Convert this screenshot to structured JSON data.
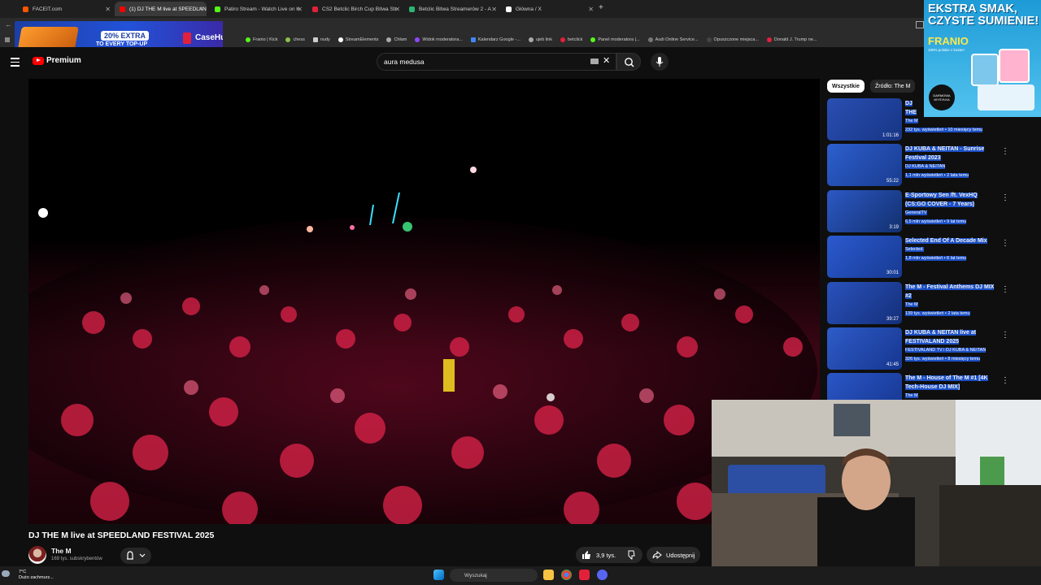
{
  "browser": {
    "tabs": [
      {
        "label": "FACEIT.com",
        "color": "#ff5500",
        "active": false
      },
      {
        "label": "(1) DJ THE M live at SPEEDLAN",
        "color": "#ff0000",
        "active": true
      },
      {
        "label": "Patiro Stream - Watch Live on K",
        "color": "#53fc18",
        "active": false
      },
      {
        "label": "CS2 Betclic Birch Cup Bitwa Str",
        "color": "#e3203a",
        "active": false
      },
      {
        "label": "Betclic Bitwa Streamerów 2 - A",
        "color": "#2bb673",
        "active": false
      },
      {
        "label": "Główna / X",
        "color": "#ffffff",
        "active": false
      }
    ],
    "bookmarks": [
      "Franio | Kick",
      "chess",
      "nudy",
      "StreamElements",
      "Chłam",
      "Widok moderatora...",
      "Kalendarz Google -...",
      "ujeb link",
      "betclick",
      "Panel moderatora |...",
      "Audi Online Service...",
      "Opuszczone miejsca...",
      "Donald J. Trump ne..."
    ]
  },
  "ad_top": {
    "badge": "20% EXTRA",
    "line2": "TO EVERY TOP-UP",
    "brand": "CaseHug"
  },
  "youtube": {
    "logo_label": "Premium",
    "search_value": "aura medusa"
  },
  "video": {
    "title": "DJ THE M live at SPEEDLAND FESTIVAL 2025",
    "channel": "The M",
    "subscribers": "169 tys. subskrybentów",
    "likes": "3,9 tys.",
    "share_label": "Udostępnij"
  },
  "sidebar": {
    "chips": [
      "Wszystkie",
      "Źródło: The M"
    ],
    "recommendations": [
      {
        "title": "DJ THE M - MIX JUWE...",
        "channel": "The M",
        "meta": "232 tys. wyświetleń • 10 miesięcy temu",
        "duration": "1:01:16",
        "thumb": "#2a4fb3"
      },
      {
        "title": "DJ KUBA & NEITAN - Sunrise Festival 2023",
        "channel": "DJ KUBA & NEITAN",
        "meta": "1,1 mln wyświetleń • 2 lata temu",
        "duration": "55:22",
        "thumb": "#2d5fce"
      },
      {
        "title": "E-Sportowy Sen /ft. VexHQ (CS:GO COVER - 7 Years)",
        "channel": "GeneralTV",
        "meta": "6,5 mln wyświetleń • 9 lat temu",
        "duration": "3:19",
        "thumb": "#2c58c4"
      },
      {
        "title": "Selected End Of A Decade Mix",
        "channel": "Selected.",
        "meta": "1,8 mln wyświetleń • 6 lat temu",
        "duration": "30:01",
        "thumb": "#2b5ad0"
      },
      {
        "title": "The M - Festival Anthems DJ MIX #2",
        "channel": "The M",
        "meta": "139 tys. wyświetleń • 2 lata temu",
        "duration": "39:27",
        "thumb": "#2a52bd"
      },
      {
        "title": "DJ KUBA & NEITAN live at FESTIVALAND 2025",
        "channel": "FESTIVALAND TV i DJ KUBA & NEITAN",
        "meta": "326 tys. wyświetleń • 8 miesięcy temu",
        "duration": "41:45",
        "thumb": "#2e5cc8"
      },
      {
        "title": "The M - House of The M #1 [4K Tech-House DJ MIX]",
        "channel": "The M",
        "meta": "",
        "duration": "",
        "thumb": "#2a56c6"
      }
    ]
  },
  "ad_right": {
    "headline": "EKSTRA SMAK, CZYSTE SUMIENIE!",
    "brand": "FRANIO",
    "small": "100% polskie z kosteri",
    "badge": "DARMOWA WYSYŁKA"
  },
  "taskbar": {
    "temp": "7°C",
    "weather": "Dużo zachmurz...",
    "search_placeholder": "Wyszukaj"
  },
  "colors": {
    "accent": "#1b4fc4",
    "yt_red": "#ff0000"
  }
}
